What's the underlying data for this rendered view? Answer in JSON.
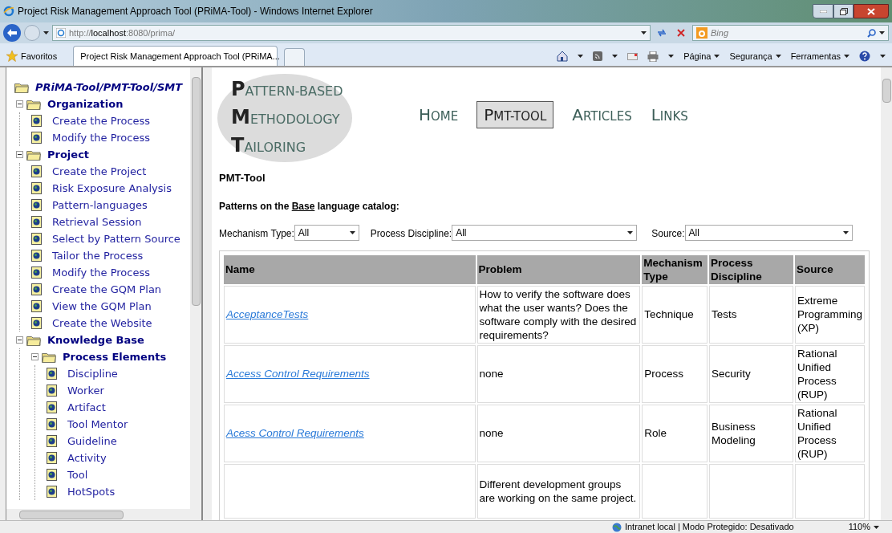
{
  "window": {
    "title": "Project Risk Management Approach Tool (PRiMA-Tool) - Windows Internet Explorer"
  },
  "address_bar": {
    "url_prefix": "http://",
    "url_host": "localhost",
    "url_rest": ":8080/prima/"
  },
  "search": {
    "placeholder": "Bing"
  },
  "favorites_bar": {
    "label": "Favoritos"
  },
  "tab": {
    "title": "Project Risk Management Approach Tool (PRiMA..."
  },
  "command_bar": [
    "Página",
    "Segurança",
    "Ferramentas"
  ],
  "tree": {
    "label": "PRiMA-Tool/PMT-Tool/SMT",
    "children": [
      {
        "label": "Organization",
        "expanded": true,
        "children": [
          {
            "label": "Create the Process"
          },
          {
            "label": "Modify the Process"
          }
        ]
      },
      {
        "label": "Project",
        "expanded": true,
        "children": [
          {
            "label": "Create the Project"
          },
          {
            "label": "Risk Exposure Analysis"
          },
          {
            "label": "Pattern-languages"
          },
          {
            "label": "Retrieval Session"
          },
          {
            "label": "Select by Pattern Source"
          },
          {
            "label": "Tailor the Process"
          },
          {
            "label": "Modify the Process"
          },
          {
            "label": "Create the GQM Plan"
          },
          {
            "label": "View the GQM Plan"
          },
          {
            "label": "Create the Website"
          }
        ]
      },
      {
        "label": "Knowledge Base",
        "expanded": true,
        "children": [
          {
            "label": "Process Elements",
            "expanded": true,
            "children": [
              {
                "label": "Discipline"
              },
              {
                "label": "Worker"
              },
              {
                "label": "Artifact"
              },
              {
                "label": "Tool Mentor"
              },
              {
                "label": "Guideline"
              },
              {
                "label": "Activity"
              },
              {
                "label": "Tool"
              },
              {
                "label": "HotSpots"
              }
            ]
          }
        ]
      }
    ]
  },
  "logo": [
    "PATTERN-BASED",
    "METHODOLOGY",
    "TAILORING"
  ],
  "nav": [
    {
      "label": "HOME",
      "selected": false
    },
    {
      "label": "PMT-TOOL",
      "selected": true
    },
    {
      "label": "ARTICLES",
      "selected": false
    },
    {
      "label": "LINKS",
      "selected": false
    }
  ],
  "heading": "PMT-Tool",
  "subheading_parts": [
    "Patterns on the ",
    "Base",
    " language catalog:"
  ],
  "filters": [
    {
      "label": "Mechanism Type:",
      "value": "All"
    },
    {
      "label": "Process Discipline:",
      "value": "All"
    },
    {
      "label": "Source:",
      "value": "All"
    }
  ],
  "table": {
    "columns": [
      "Name",
      "Problem",
      "Mechanism Type",
      "Process Discipline",
      "Source"
    ],
    "rows": [
      [
        "AcceptanceTests",
        "How to verify the software does what the user wants? Does the software comply with the desired requirements?",
        "Technique",
        "Tests",
        "Extreme Programming (XP)"
      ],
      [
        "Access Control Requirements",
        "none",
        "Process",
        "Security",
        "Rational Unified Process (RUP)"
      ],
      [
        "Acess Control Requirements",
        "none",
        "Role",
        "Business Modeling",
        "Rational Unified Process (RUP)"
      ],
      [
        "",
        "Different development groups are working on the same project.",
        "",
        "",
        ""
      ]
    ]
  },
  "status_bar": {
    "zone": "Intranet local | Modo Protegido: Desativado",
    "zoom": "110%"
  }
}
